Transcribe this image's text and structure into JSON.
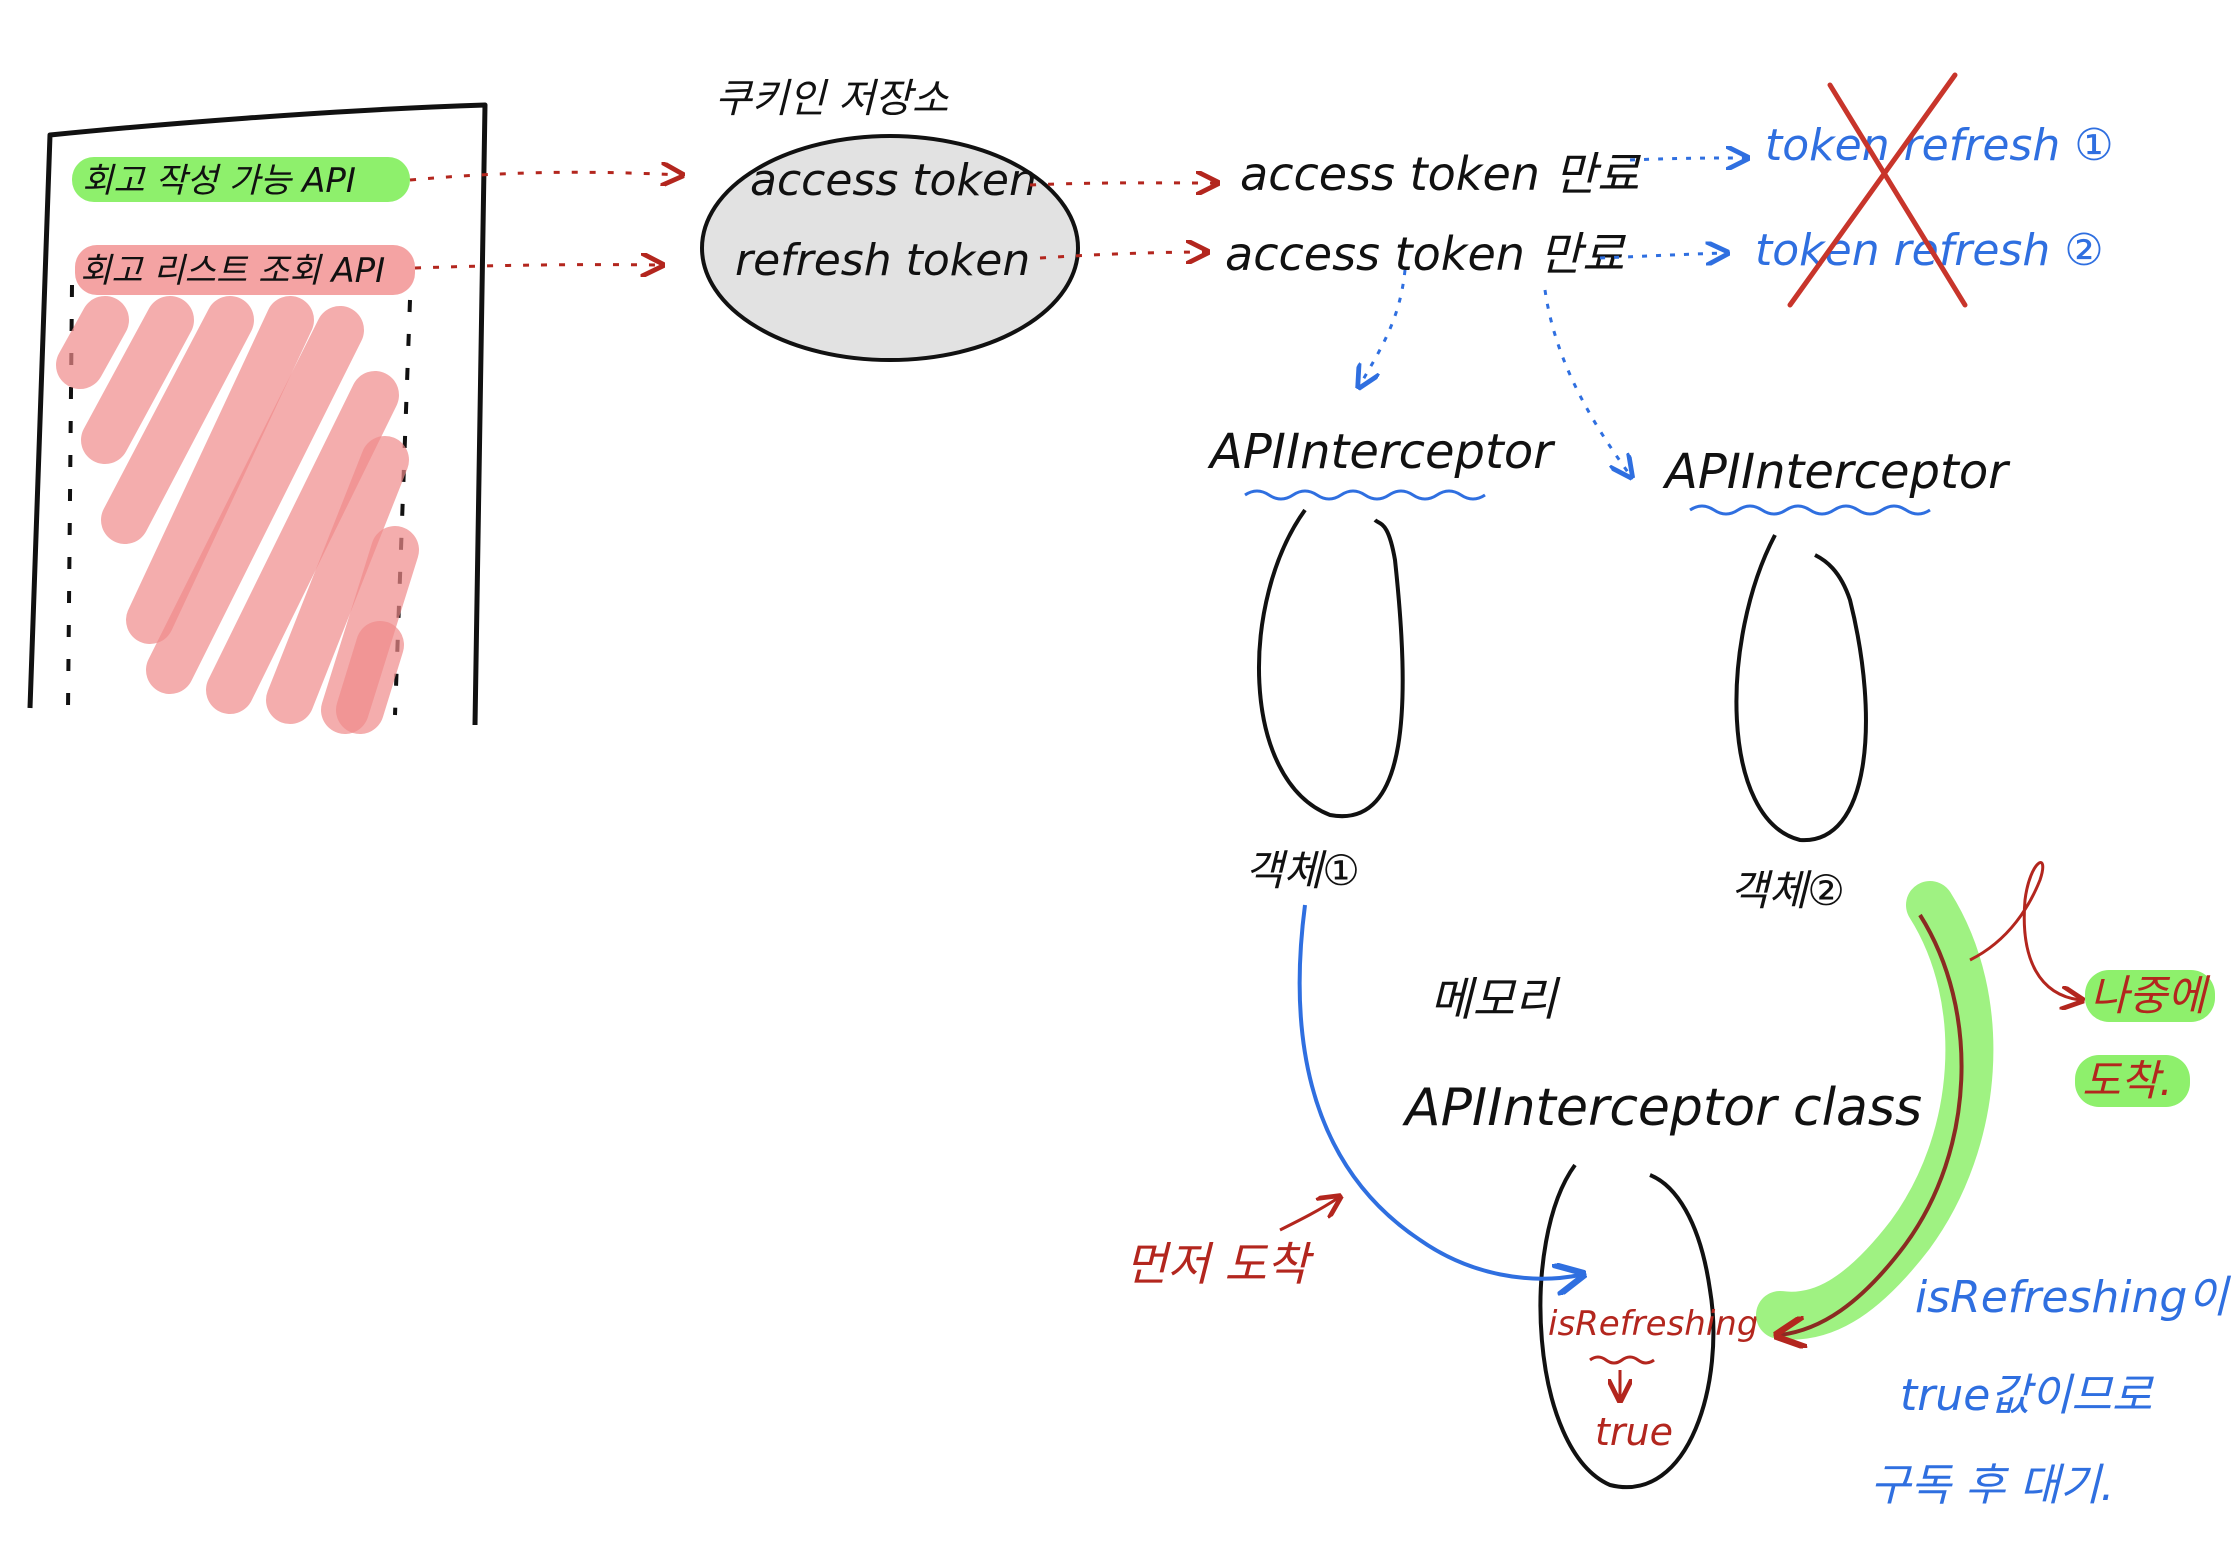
{
  "phone": {
    "api_write": "회고 작성 가능 API",
    "api_list": "회고 리스트 조회 API"
  },
  "storage": {
    "title": "쿠키인 저장소",
    "access_token": "access token",
    "refresh_token": "refresh token"
  },
  "expiry": {
    "row1": "access token 만료",
    "row2": "access token 만료"
  },
  "refresh": {
    "r1": "token refresh ①",
    "r2": "token refresh ②"
  },
  "interceptors": {
    "left_label": "APIInterceptor",
    "right_label": "APIInterceptor",
    "object1": "객체①",
    "object2": "객체②"
  },
  "memory": {
    "line1": "메모리",
    "line2": "APIInterceptor class",
    "flag": "isRefreshing",
    "flag_value": "true"
  },
  "annotations": {
    "first_arrive": "먼저 도착",
    "later_line1": "나중에",
    "later_line2": "도착.",
    "wait_line1": "isRefreshing이",
    "wait_line2": "true값이므로",
    "wait_line3": "구독 후 대기."
  },
  "colors": {
    "red": "#b3261e",
    "blue": "#2f6fe0",
    "green_highlight": "#8ef06c",
    "pink_highlight": "#f4a3a3",
    "storage_fill": "#e2e2e2"
  }
}
